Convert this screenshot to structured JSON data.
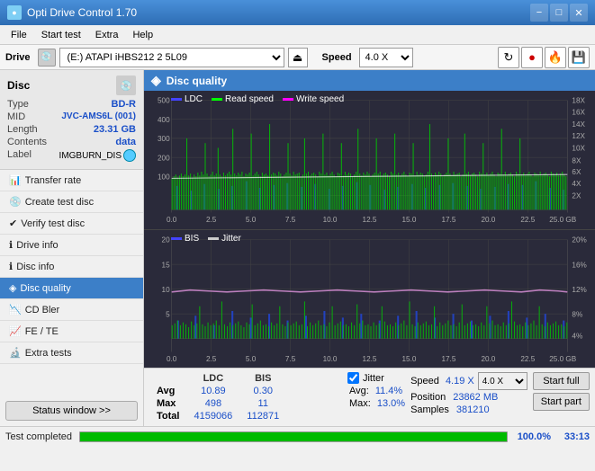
{
  "titleBar": {
    "appName": "Opti Drive Control 1.70",
    "minBtn": "−",
    "maxBtn": "□",
    "closeBtn": "✕"
  },
  "menuBar": {
    "items": [
      "File",
      "Start test",
      "Extra",
      "Help"
    ]
  },
  "driveBar": {
    "label": "Drive",
    "driveValue": "(E:)  ATAPI iHBS212  2 5L09",
    "speedLabel": "Speed",
    "speedValue": "4.0 X"
  },
  "sidebar": {
    "discSection": {
      "title": "Disc",
      "typeLabel": "Type",
      "typeValue": "BD-R",
      "midLabel": "MID",
      "midValue": "JVC-AMS6L (001)",
      "lengthLabel": "Length",
      "lengthValue": "23.31 GB",
      "contentsLabel": "Contents",
      "contentsValue": "data",
      "labelLabel": "Label",
      "labelValue": "IMGBURN_DIS"
    },
    "navItems": [
      {
        "id": "transfer-rate",
        "label": "Transfer rate",
        "active": false
      },
      {
        "id": "create-test-disc",
        "label": "Create test disc",
        "active": false
      },
      {
        "id": "verify-test-disc",
        "label": "Verify test disc",
        "active": false
      },
      {
        "id": "drive-info",
        "label": "Drive info",
        "active": false
      },
      {
        "id": "disc-info",
        "label": "Disc info",
        "active": false
      },
      {
        "id": "disc-quality",
        "label": "Disc quality",
        "active": true
      },
      {
        "id": "cd-bler",
        "label": "CD Bler",
        "active": false
      },
      {
        "id": "fe-te",
        "label": "FE / TE",
        "active": false
      },
      {
        "id": "extra-tests",
        "label": "Extra tests",
        "active": false
      }
    ],
    "statusBtn": "Status window >>"
  },
  "contentHeader": {
    "icon": "◈",
    "title": "Disc quality"
  },
  "chart1": {
    "legend": [
      {
        "id": "ldc",
        "label": "LDC"
      },
      {
        "id": "read",
        "label": "Read speed"
      },
      {
        "id": "write",
        "label": "Write speed"
      }
    ],
    "yAxisMax": 500,
    "yAxisRight": [
      "18X",
      "16X",
      "14X",
      "12X",
      "10X",
      "8X",
      "6X",
      "4X",
      "2X"
    ],
    "xAxisLabels": [
      "0.0",
      "2.5",
      "5.0",
      "7.5",
      "10.0",
      "12.5",
      "15.0",
      "17.5",
      "20.0",
      "22.5",
      "25.0 GB"
    ]
  },
  "chart2": {
    "legend": [
      {
        "id": "bis",
        "label": "BIS"
      },
      {
        "id": "jitter",
        "label": "Jitter"
      }
    ],
    "yAxisMax": 20,
    "yAxisRight": [
      "20%",
      "16%",
      "12%",
      "8%",
      "4%"
    ],
    "xAxisLabels": [
      "0.0",
      "2.5",
      "5.0",
      "7.5",
      "10.0",
      "12.5",
      "15.0",
      "17.5",
      "20.0",
      "22.5",
      "25.0 GB"
    ]
  },
  "stats": {
    "headers": [
      "",
      "LDC",
      "BIS"
    ],
    "rows": [
      {
        "label": "Avg",
        "ldc": "10.89",
        "bis": "0.30"
      },
      {
        "label": "Max",
        "ldc": "498",
        "bis": "11"
      },
      {
        "label": "Total",
        "ldc": "4159066",
        "bis": "112871"
      }
    ],
    "jitter": {
      "label": "Jitter",
      "avg": "11.4%",
      "max": "13.0%"
    },
    "speed": {
      "label": "Speed",
      "value": "4.19 X",
      "selectValue": "4.0 X",
      "positionLabel": "Position",
      "positionValue": "23862 MB",
      "samplesLabel": "Samples",
      "samplesValue": "381210"
    },
    "buttons": {
      "startFull": "Start full",
      "startPart": "Start part"
    }
  },
  "statusBar": {
    "text": "Test completed",
    "progressPct": "100.0%",
    "time": "33:13"
  }
}
